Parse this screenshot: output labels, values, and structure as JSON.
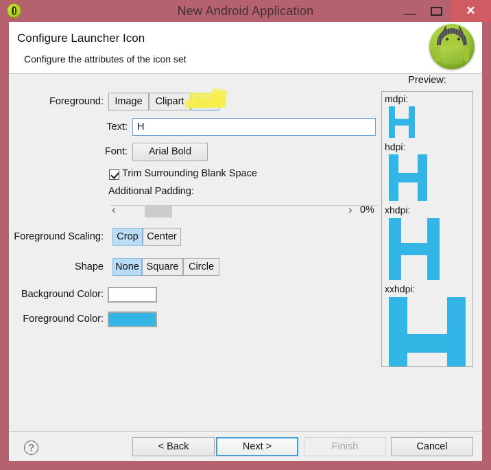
{
  "window": {
    "title": "New Android Application",
    "app_icon": "android-app-icon",
    "minimize_label": "—",
    "maximize_label": "□",
    "close_label": "✕",
    "frame_color": "#b5616e",
    "close_button_color": "#d05c63"
  },
  "header": {
    "title": "Configure Launcher Icon",
    "subtitle": "Configure the attributes of the icon set",
    "logo": "android-robot-logo"
  },
  "form": {
    "foreground": {
      "label": "Foreground:",
      "options": [
        "Image",
        "Clipart",
        "Text"
      ],
      "selected": "Text"
    },
    "text": {
      "label": "Text:",
      "value": "H",
      "placeholder": ""
    },
    "font": {
      "label": "Font:",
      "value": "Arial Bold"
    },
    "trim": {
      "label": "Trim Surrounding Blank Space",
      "checked": true
    },
    "padding": {
      "label": "Additional Padding:",
      "value": "0%",
      "left_arrow": "‹",
      "right_arrow": "›"
    },
    "scaling": {
      "label": "Foreground Scaling:",
      "options": [
        "Crop",
        "Center"
      ],
      "selected": "Crop"
    },
    "shape": {
      "label": "Shape",
      "options": [
        "None",
        "Square",
        "Circle"
      ],
      "selected": "None"
    },
    "background_color": {
      "label": "Background Color:",
      "value": "#ffffff"
    },
    "foreground_color": {
      "label": "Foreground Color:",
      "value": "#33b5e5"
    }
  },
  "preview": {
    "label": "Preview:",
    "glyph": "H",
    "glyph_color": "#33b5e5",
    "densities": [
      {
        "label": "mdpi:"
      },
      {
        "label": "hdpi:"
      },
      {
        "label": "xhdpi:"
      },
      {
        "label": "xxhdpi:"
      }
    ]
  },
  "annotation": {
    "type": "highlighter-marker",
    "color": "#f7ef4a",
    "target": "Text"
  },
  "footer": {
    "help": "?",
    "buttons": [
      {
        "label": "< Back",
        "state": "normal"
      },
      {
        "label": "Next >",
        "state": "focused"
      },
      {
        "label": "Finish",
        "state": "disabled"
      },
      {
        "label": "Cancel",
        "state": "normal"
      }
    ]
  }
}
